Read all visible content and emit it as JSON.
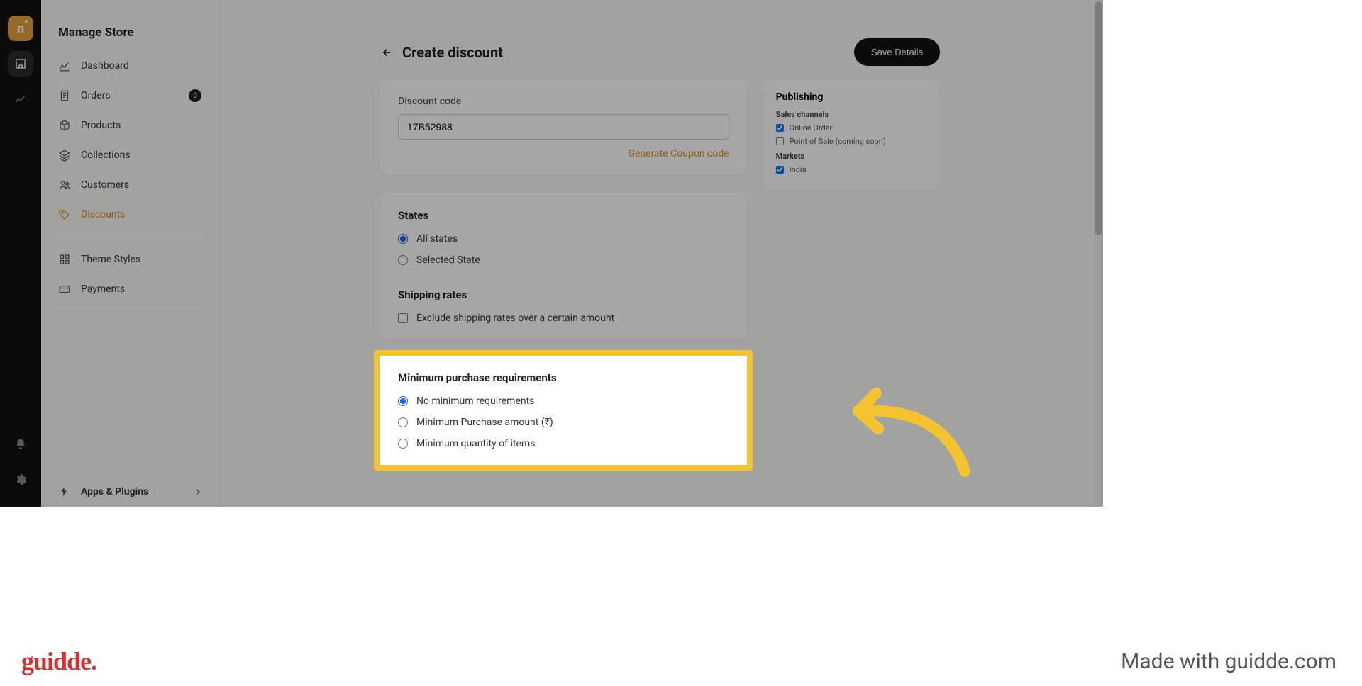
{
  "rail": {
    "logo_letter": "n"
  },
  "sidebar": {
    "title": "Manage Store",
    "items": [
      {
        "label": "Dashboard"
      },
      {
        "label": "Orders",
        "badge": "0"
      },
      {
        "label": "Products"
      },
      {
        "label": "Collections"
      },
      {
        "label": "Customers"
      },
      {
        "label": "Discounts"
      },
      {
        "label": "Theme Styles"
      },
      {
        "label": "Payments"
      }
    ],
    "bottom": {
      "label": "Apps & Plugins"
    }
  },
  "header": {
    "title": "Create discount",
    "save": "Save Details"
  },
  "discount_code": {
    "label": "Discount code",
    "value": "17B52988",
    "generate": "Generate Coupon code"
  },
  "states": {
    "title": "States",
    "all": "All states",
    "selected": "Selected State"
  },
  "shipping": {
    "title": "Shipping rates",
    "exclude": "Exclude shipping rates over a certain amount"
  },
  "min_purchase": {
    "title": "Minimum purchase requirements",
    "none": "No minimum requirements",
    "amount": "Minimum Purchase amount (₹)",
    "qty": "Minimum quantity of items"
  },
  "publishing": {
    "title": "Publishing",
    "sales_channels_label": "Sales channels",
    "online": "Online Order",
    "pos": "Point of Sale (coming soon)",
    "markets_label": "Markets",
    "india": "India"
  },
  "footer": {
    "logo": "guidde.",
    "made": "Made with guidde.com"
  }
}
